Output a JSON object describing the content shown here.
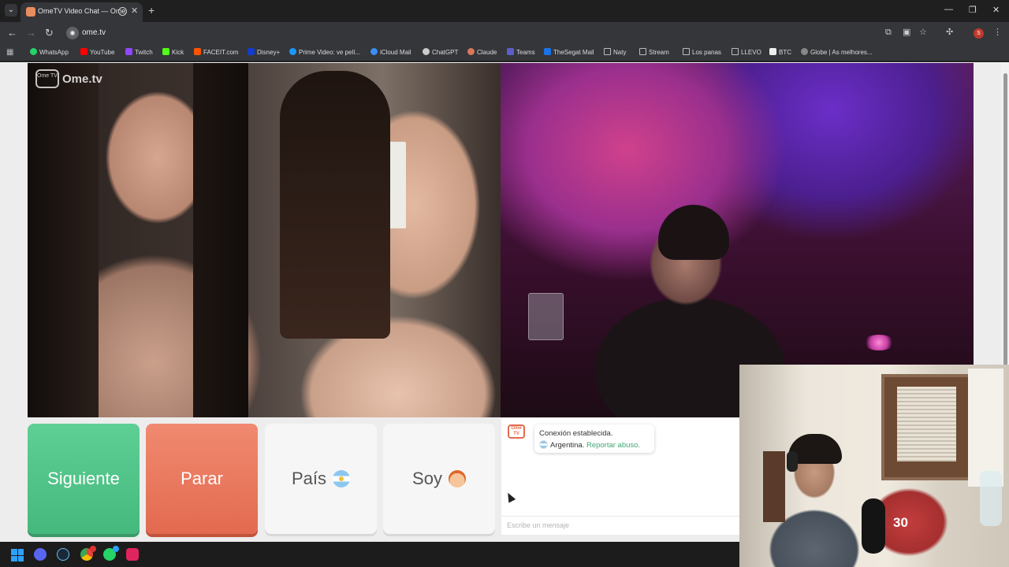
{
  "browser": {
    "tab_title": "OmeTV Video Chat — Ome",
    "url": "ome.tv",
    "bookmarks": [
      {
        "label": "WhatsApp",
        "color": "#25d366"
      },
      {
        "label": "YouTube",
        "color": "#ff0000"
      },
      {
        "label": "Twitch",
        "color": "#9146ff"
      },
      {
        "label": "Kick",
        "color": "#53fc18"
      },
      {
        "label": "FACEIT.com",
        "color": "#ff5500"
      },
      {
        "label": "Disney+",
        "color": "#113ccf"
      },
      {
        "label": "Prime Video: ve pelí...",
        "color": "#1a98ff"
      },
      {
        "label": "iCloud Mail",
        "color": "#3a8ef6"
      },
      {
        "label": "ChatGPT",
        "color": "#cccccc"
      },
      {
        "label": "Claude",
        "color": "#d97757"
      },
      {
        "label": "Teams",
        "color": "#5b5fc7"
      },
      {
        "label": "TheSegat Mail",
        "color": "#1a73e8"
      },
      {
        "label": "Naty",
        "color": "folder"
      },
      {
        "label": "Stream",
        "color": "folder"
      },
      {
        "label": "Los panas",
        "color": "folder"
      },
      {
        "label": "LLEVO",
        "color": "folder"
      },
      {
        "label": "BTC",
        "color": "#eeeeee"
      },
      {
        "label": "Globe | As melhores...",
        "color": "#888888"
      }
    ]
  },
  "page": {
    "logo": {
      "badge": "Ome TV",
      "brand": "Ome.tv"
    },
    "buttons": {
      "next": "Siguiente",
      "stop": "Parar",
      "country": "País",
      "gender": "Soy"
    },
    "chat": {
      "logo": "Ome TV",
      "status": "Conexión establecida.",
      "country": "Argentina.",
      "report": "Reportar abuso.",
      "input_placeholder": "Escribe un mensaje"
    }
  },
  "webcam": {
    "jersey_number": "30"
  },
  "colors": {
    "next_button": "#45b97d",
    "stop_button": "#e36a4f",
    "link": "#3fa872"
  }
}
